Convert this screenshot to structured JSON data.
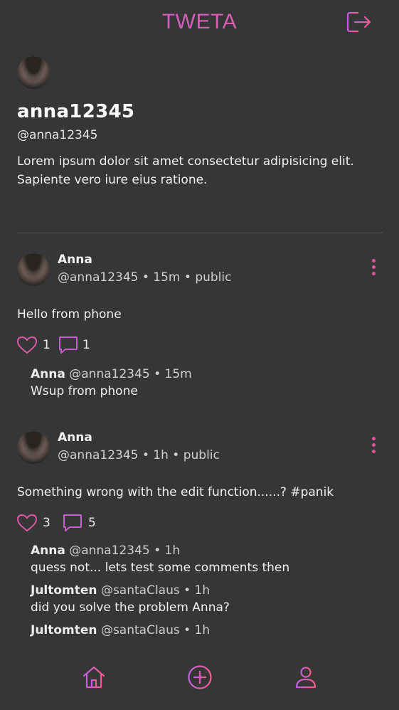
{
  "app": {
    "title": "TWETA"
  },
  "colors": {
    "accent_pink": "#f25c8c",
    "accent_purple": "#b760e6",
    "background": "#363636"
  },
  "header": {
    "logout_icon": "logout-icon"
  },
  "profile": {
    "display_name": "anna12345",
    "handle": "@anna12345",
    "bio": "Lorem ipsum dolor sit amet consectetur adipisicing elit. Sapiente vero iure eius ratione."
  },
  "posts": [
    {
      "author": "Anna",
      "meta": "@anna12345 • 15m • public",
      "text": "Hello from phone",
      "likes": "1",
      "comments_count": "1",
      "comments": [
        {
          "author": "Anna",
          "meta": "@anna12345 • 15m",
          "text": "Wsup from phone"
        }
      ]
    },
    {
      "author": "Anna",
      "meta": "@anna12345 • 1h • public",
      "text": "Something wrong with the edit function......? #panik",
      "likes": "3",
      "comments_count": "5",
      "comments": [
        {
          "author": "Anna",
          "meta": "@anna12345 • 1h",
          "text": "quess not... lets test some comments then"
        },
        {
          "author": "Jultomten",
          "meta": "@santaClaus • 1h",
          "text": "did you solve the problem Anna?"
        },
        {
          "author": "Jultomten",
          "meta": "@santaClaus • 1h",
          "text": ""
        }
      ]
    }
  ],
  "bottom_nav": {
    "items": [
      "home-icon",
      "add-post-icon",
      "profile-icon"
    ]
  }
}
